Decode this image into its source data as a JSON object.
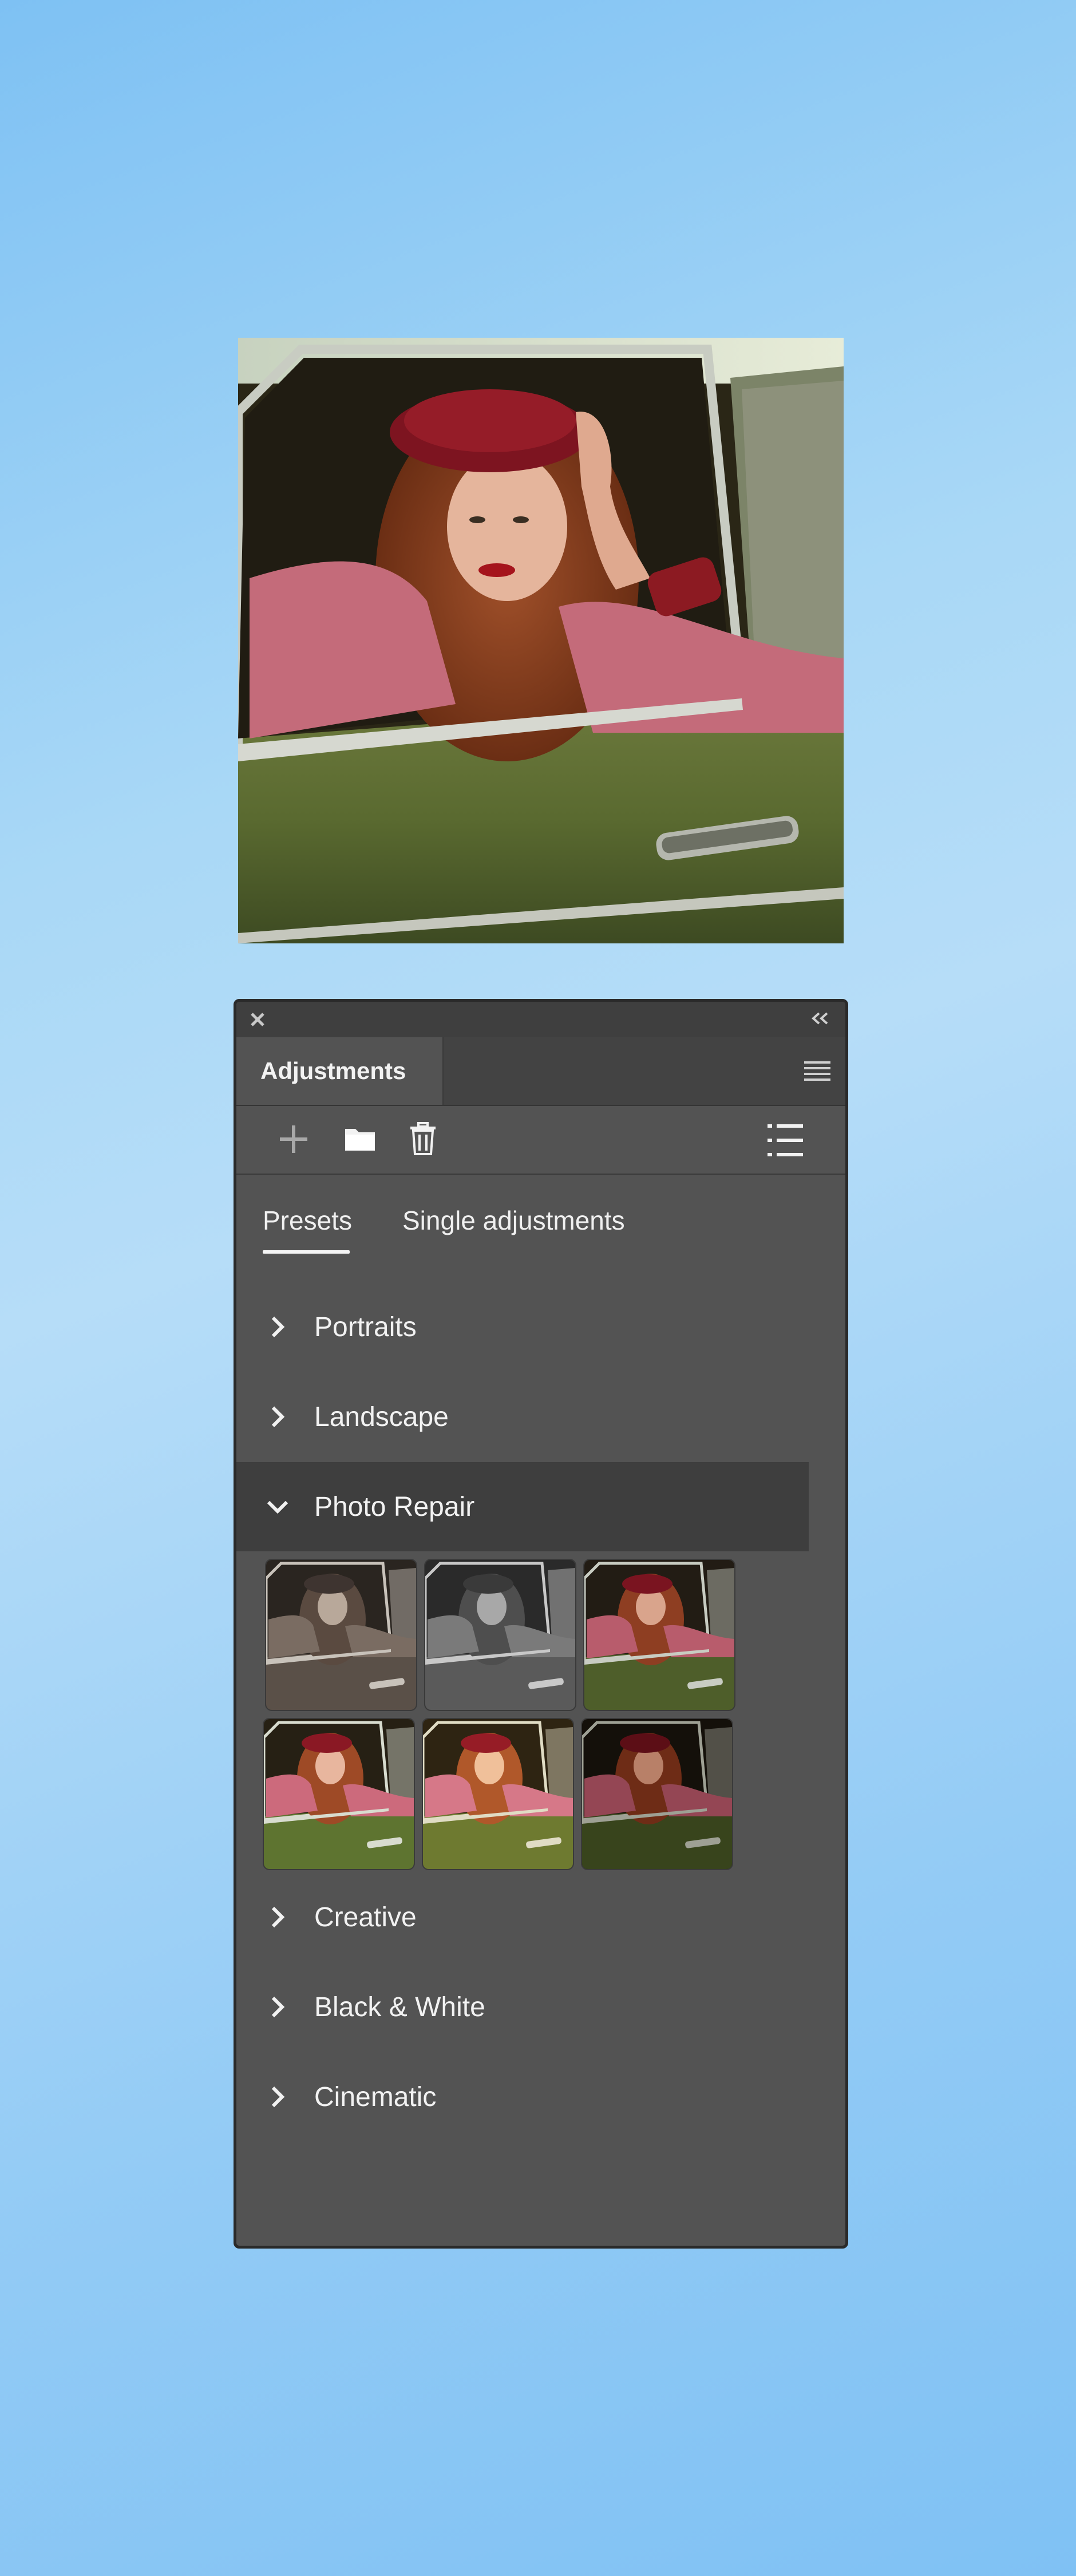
{
  "panel": {
    "tab_title": "Adjustments"
  },
  "toolbar": {
    "add_icon": "plus-icon",
    "folder_icon": "folder-icon",
    "delete_icon": "trash-icon",
    "list_icon": "list-view-icon"
  },
  "subtabs": {
    "presets": "Presets",
    "single": "Single adjustments"
  },
  "groups": [
    {
      "label": "Portraits",
      "expanded": false
    },
    {
      "label": "Landscape",
      "expanded": false
    },
    {
      "label": "Photo Repair",
      "expanded": true
    },
    {
      "label": "Creative",
      "expanded": false
    },
    {
      "label": "Black & White",
      "expanded": false
    },
    {
      "label": "Cinematic",
      "expanded": false
    }
  ],
  "photo_repair_presets": [
    {
      "name": "preset-1",
      "tone": "warm-mono"
    },
    {
      "name": "preset-2",
      "tone": "gray-mono"
    },
    {
      "name": "preset-3",
      "tone": "color"
    },
    {
      "name": "preset-4",
      "tone": "color-bright"
    },
    {
      "name": "preset-5",
      "tone": "color-warm"
    },
    {
      "name": "preset-6",
      "tone": "color-dark"
    }
  ],
  "colors": {
    "panel_bg": "#535353",
    "titlebar_bg": "#3f3f3f",
    "selected_group_bg": "#3e3e3e",
    "text": "#f2f2f2"
  }
}
